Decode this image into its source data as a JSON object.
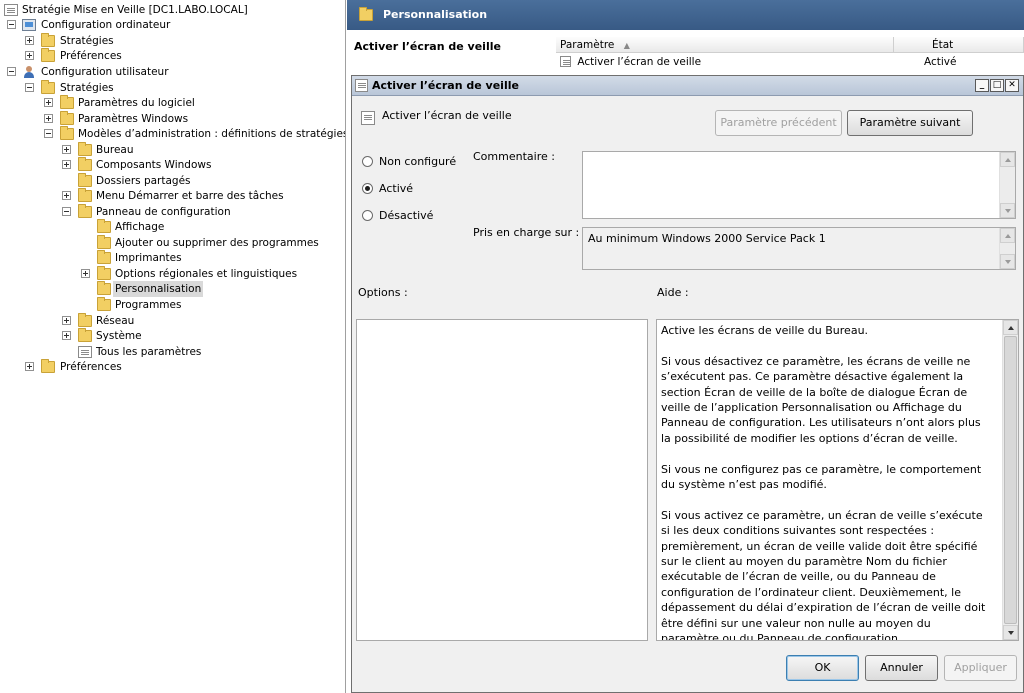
{
  "tree": {
    "root": "Stratégie Mise en Veille [DC1.LABO.LOCAL]",
    "computer_config": "Configuration ordinateur",
    "cc_strategies": "Stratégies",
    "cc_preferences": "Préférences",
    "user_config": "Configuration utilisateur",
    "uc_strategies": "Stratégies",
    "software_settings": "Paramètres du logiciel",
    "windows_settings": "Paramètres Windows",
    "admin_templates": "Modèles d’administration : définitions de stratégies (fichie",
    "desktop": "Bureau",
    "windows_components": "Composants Windows",
    "shared_folders": "Dossiers partagés",
    "start_menu": "Menu Démarrer et barre des tâches",
    "control_panel": "Panneau de configuration",
    "display": "Affichage",
    "add_remove": "Ajouter ou supprimer des programmes",
    "printers": "Imprimantes",
    "regional": "Options régionales et linguistiques",
    "personalization": "Personnalisation",
    "programs": "Programmes",
    "network": "Réseau",
    "system": "Système",
    "all_settings": "Tous les paramètres",
    "uc_preferences": "Préférences"
  },
  "background": {
    "header": "Personnalisation",
    "description_title": "Activer l’écran de veille",
    "col_setting": "Paramètre",
    "col_state": "État",
    "row_setting": "Activer l’écran de veille",
    "row_state": "Activé"
  },
  "dialog": {
    "title": "Activer l’écran de veille",
    "policy_name": "Activer l’écran de veille",
    "prev_button": "Paramètre précédent",
    "next_button": "Paramètre suivant",
    "radio_not_configured": "Non configuré",
    "radio_enabled": "Activé",
    "radio_disabled": "Désactivé",
    "comment_label": "Commentaire :",
    "supported_label": "Pris en charge sur :",
    "supported_value": "Au minimum Windows 2000 Service Pack 1",
    "options_label": "Options :",
    "help_label": "Aide :",
    "help_paragraphs": [
      "Active les écrans de veille du Bureau.",
      "Si vous désactivez ce paramètre, les écrans de veille ne s’exécutent pas. Ce paramètre désactive également la section Écran de veille de la boîte de dialogue Écran de veille de l’application Personnalisation ou Affichage du Panneau de configuration. Les utilisateurs n’ont alors plus la possibilité de modifier les options d’écran de veille.",
      "Si vous ne configurez pas ce paramètre, le comportement du système n’est pas modifié.",
      "Si vous activez ce paramètre, un écran de veille s’exécute si les deux conditions suivantes sont respectées : premièrement, un écran de veille valide doit être spécifié sur le client au moyen du paramètre Nom du fichier exécutable de l’écran de veille, ou du Panneau de configuration de l’ordinateur client. Deuxièmement, le dépassement du délai d’expiration de l’écran de veille doit être défini sur une valeur non nulle au moyen du paramètre ou du Panneau de configuration."
    ],
    "ok_button": "OK",
    "cancel_button": "Annuler",
    "apply_button": "Appliquer",
    "selected_radio": "enabled"
  },
  "colors": {
    "header_blue": "#4a6f9b",
    "folder_yellow": "#f2cf63",
    "dialog_bg": "#f0f0f0"
  }
}
